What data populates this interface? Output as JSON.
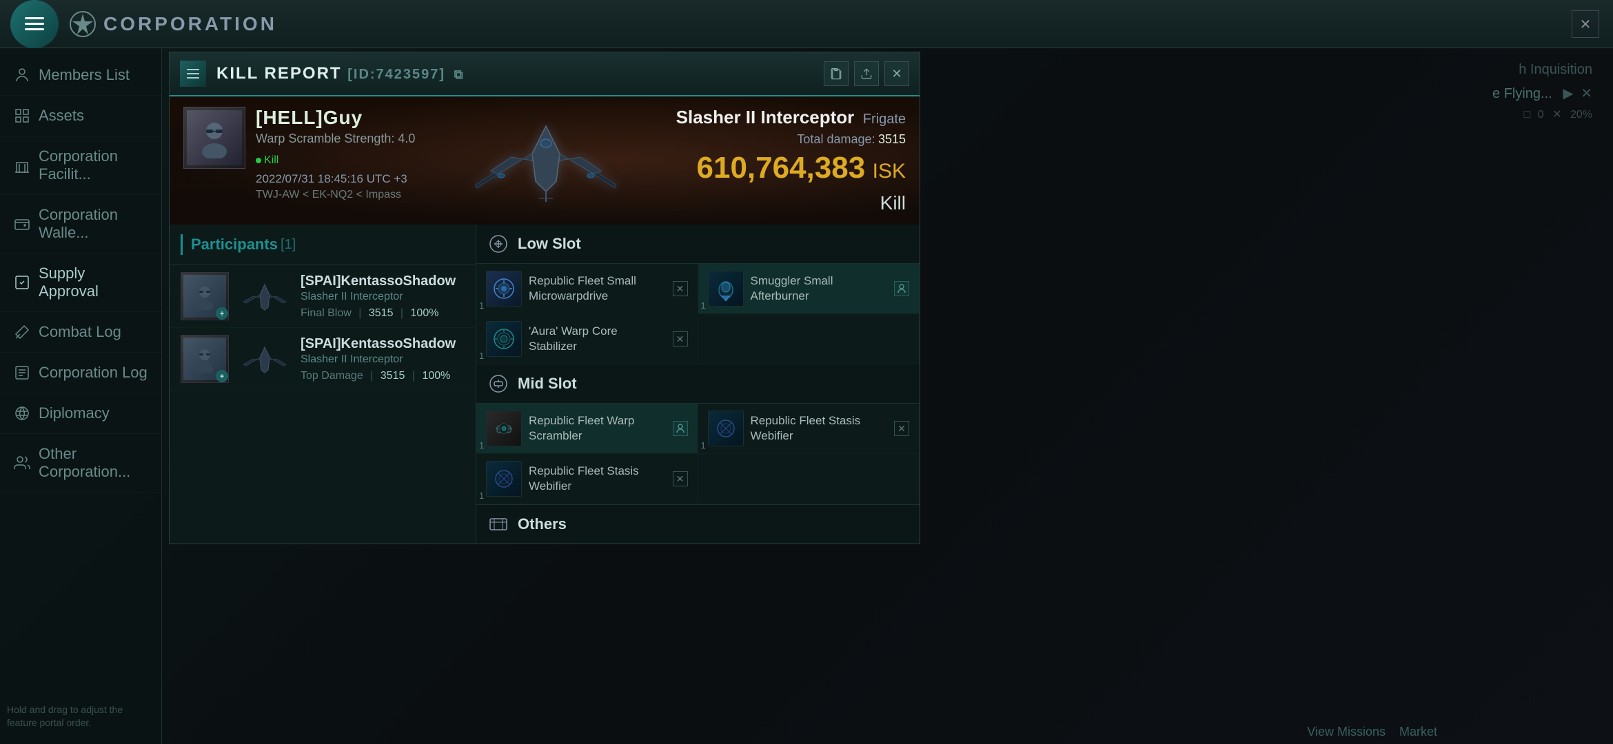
{
  "app": {
    "title": "CORPORATION",
    "close_label": "✕"
  },
  "sidebar": {
    "items": [
      {
        "id": "members-list",
        "label": "Members List",
        "icon": "person"
      },
      {
        "id": "assets",
        "label": "Assets",
        "icon": "assets"
      },
      {
        "id": "corp-facilities",
        "label": "Corporation Facilit...",
        "icon": "building"
      },
      {
        "id": "corp-wallet",
        "label": "Corporation Walle...",
        "icon": "wallet"
      },
      {
        "id": "supply-approval",
        "label": "Supply Approval",
        "icon": "approval"
      },
      {
        "id": "combat-log",
        "label": "Combat Log",
        "icon": "combat"
      },
      {
        "id": "corporation-log",
        "label": "Corporation Log",
        "icon": "log"
      },
      {
        "id": "diplomacy",
        "label": "Diplomacy",
        "icon": "diplomacy"
      },
      {
        "id": "other-corporations",
        "label": "Other Corporation...",
        "icon": "other"
      }
    ],
    "footer_text": "Hold and drag to adjust the feature portal order."
  },
  "kill_report": {
    "title": "KILL REPORT",
    "id": "[ID:7423597]",
    "id_copy_icon": "copy-icon",
    "victim": {
      "name": "[HELL]Guy",
      "warp_scramble_strength": "Warp Scramble Strength: 4.0",
      "status": "Kill",
      "timestamp": "2022/07/31 18:45:16 UTC +3",
      "location": "TWJ-AW < EK-NQ2 < Impass"
    },
    "ship": {
      "name": "Slasher II Interceptor",
      "class": "Frigate",
      "total_damage_label": "Total damage:",
      "total_damage": "3515",
      "isk_value": "610,764,383",
      "isk_label": "ISK",
      "outcome": "Kill"
    },
    "participants": {
      "title": "Participants",
      "count": "[1]",
      "list": [
        {
          "name": "[SPAI]KentassoShadow",
          "ship": "Slasher II Interceptor",
          "blow_type": "Final Blow",
          "damage": "3515",
          "percent": "100%"
        },
        {
          "name": "[SPAI]KentassoShadow",
          "ship": "Slasher II Interceptor",
          "blow_type": "Top Damage",
          "damage": "3515",
          "percent": "100%"
        }
      ]
    },
    "modules": {
      "low_slot": {
        "title": "Low Slot",
        "items": [
          {
            "qty": 1,
            "name": "Republic Fleet Small Microwarpdrive",
            "has_x": true,
            "highlighted": false
          },
          {
            "qty": 1,
            "name": "Smuggler Small Afterburner",
            "has_x": false,
            "highlighted": true,
            "has_person": true
          },
          {
            "qty": 1,
            "name": "'Aura' Warp Core Stabilizer",
            "has_x": true,
            "highlighted": false
          }
        ]
      },
      "mid_slot": {
        "title": "Mid Slot",
        "items": [
          {
            "qty": 1,
            "name": "Republic Fleet Warp Scrambler",
            "has_x": false,
            "highlighted": true,
            "has_person": true
          },
          {
            "qty": 1,
            "name": "Republic Fleet Stasis Webifier",
            "has_x": true,
            "highlighted": false
          },
          {
            "qty": 1,
            "name": "Republic Fleet Stasis Webifier",
            "has_x": true,
            "highlighted": false
          }
        ]
      },
      "others": {
        "title": "Others"
      }
    }
  },
  "right_panel": {
    "text1": "h Inquisition",
    "text2": "e Flying...",
    "bottom_link1": "View Missions",
    "bottom_link2": "Market"
  }
}
